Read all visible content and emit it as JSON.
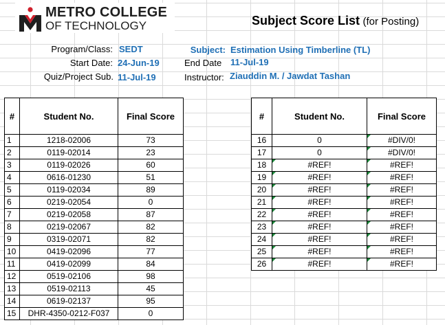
{
  "logo": {
    "line1": "METRO COLLEGE",
    "line2": "OF TECHNOLOGY"
  },
  "title": {
    "main": "Subject Score List",
    "sub": "(for Posting)"
  },
  "info": {
    "program_label": "Program/Class:",
    "program_value": "SEDT",
    "start_label": "Start Date:",
    "start_value": "24-Jun-19",
    "quiz_label": "Quiz/Project Sub.",
    "quiz_value": "11-Jul-19",
    "subject_label": "Subject:",
    "subject_value": "Estimation Using Timberline (TL)",
    "end_label": "End Date",
    "end_value": "11-Jul-19",
    "instructor_label": "Instructor:",
    "instructor_value": "Ziauddin M. / Jawdat Tashan"
  },
  "left_table": {
    "headers": [
      "#",
      "Student No.",
      "Final Score"
    ],
    "rows": [
      [
        "1",
        "1218-02006",
        "73"
      ],
      [
        "2",
        "0119-02014",
        "23"
      ],
      [
        "3",
        "0119-02026",
        "60"
      ],
      [
        "4",
        "0616-01230",
        "51"
      ],
      [
        "5",
        "0119-02034",
        "89"
      ],
      [
        "6",
        "0219-02054",
        "0"
      ],
      [
        "7",
        "0219-02058",
        "87"
      ],
      [
        "8",
        "0219-02067",
        "82"
      ],
      [
        "9",
        "0319-02071",
        "82"
      ],
      [
        "10",
        "0419-02096",
        "77"
      ],
      [
        "11",
        "0419-02099",
        "84"
      ],
      [
        "12",
        "0519-02106",
        "98"
      ],
      [
        "13",
        "0519-02113",
        "45"
      ],
      [
        "14",
        "0619-02137",
        "95"
      ],
      [
        "15",
        "DHR-4350-0212-F037",
        "0"
      ]
    ]
  },
  "right_table": {
    "headers": [
      "#",
      "Student No.",
      "Final Score"
    ],
    "rows": [
      [
        "16",
        "0",
        "#DIV/0!"
      ],
      [
        "17",
        "0",
        "#DIV/0!"
      ],
      [
        "18",
        "#REF!",
        "#REF!"
      ],
      [
        "19",
        "#REF!",
        "#REF!"
      ],
      [
        "20",
        "#REF!",
        "#REF!"
      ],
      [
        "21",
        "#REF!",
        "#REF!"
      ],
      [
        "22",
        "#REF!",
        "#REF!"
      ],
      [
        "23",
        "#REF!",
        "#REF!"
      ],
      [
        "24",
        "#REF!",
        "#REF!"
      ],
      [
        "25",
        "#REF!",
        "#REF!"
      ],
      [
        "26",
        "#REF!",
        "#REF!"
      ]
    ]
  },
  "colors": {
    "accent": "#1f6fb5",
    "logo_red": "#d0202c",
    "indicator": "#1e8a3c"
  }
}
